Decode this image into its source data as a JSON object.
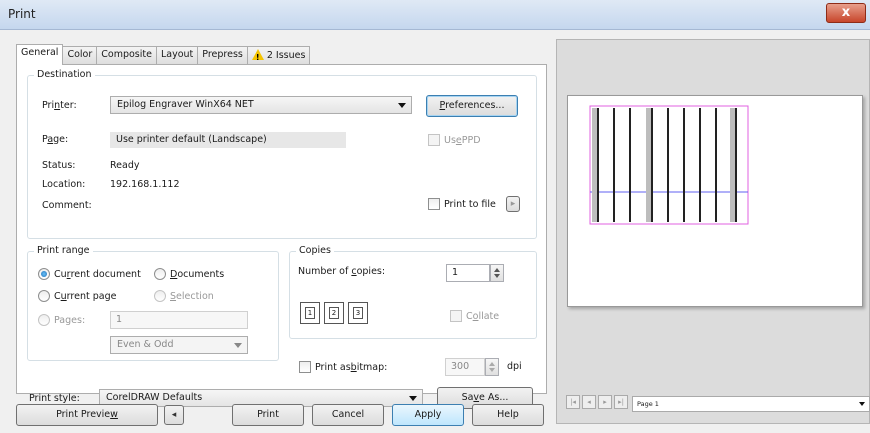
{
  "window": {
    "title": "Print",
    "close_glyph": "x"
  },
  "tabs": [
    {
      "label": "General"
    },
    {
      "label": "Color"
    },
    {
      "label": "Composite"
    },
    {
      "label": "Layout"
    },
    {
      "label": "Prepress"
    },
    {
      "label": "2 Issues",
      "icon": "warning-icon"
    }
  ],
  "destination": {
    "group_title": "Destination",
    "printer_label_pre": "Pri",
    "printer_label_u": "n",
    "printer_label_post": "ter:",
    "printer_value": "Epilog Engraver WinX64 NET",
    "preferences_pre": "",
    "preferences_u": "P",
    "preferences_post": "references...",
    "page_label_pre": "P",
    "page_label_u": "a",
    "page_label_post": "ge:",
    "page_value": "Use printer default (Landscape)",
    "use_ppd_pre": "Us",
    "use_ppd_u": "e",
    "use_ppd_post": " PPD",
    "status_label": "Status:",
    "status_value": "Ready",
    "location_label": "Location:",
    "location_value": "192.168.1.112",
    "comment_label": "Comment:",
    "print_to_file_label": "Print to file",
    "print_to_file_arrow": "▸"
  },
  "print_range": {
    "group_title": "Print range",
    "current_document_pre": "Cu",
    "current_document_u": "r",
    "current_document_post": "rent document",
    "documents_pre": "",
    "documents_u": "D",
    "documents_post": "ocuments",
    "current_page_pre": "C",
    "current_page_u": "u",
    "current_page_post": "rrent page",
    "selection_pre": "",
    "selection_u": "S",
    "selection_post": "election",
    "pages_label": "Pages:",
    "pages_value": "1",
    "odd_even_value": "Even & Odd",
    "selected": "current_document"
  },
  "copies": {
    "group_title": "Copies",
    "number_label_pre": "Number of ",
    "number_label_u": "c",
    "number_label_post": "opies:",
    "number_value": "1",
    "collate_label_pre": "C",
    "collate_label_u": "o",
    "collate_label_post": "llate",
    "collate_icon_labels": [
      "1",
      "2",
      "3"
    ]
  },
  "bitmap": {
    "label_pre": "Print as ",
    "label_u": "b",
    "label_post": "itmap:",
    "dpi_value": "300",
    "dpi_unit": "dpi"
  },
  "style": {
    "label": "Print style:",
    "value": "CorelDRAW Defaults",
    "save_as_pre": "Sa",
    "save_as_u": "v",
    "save_as_post": "e As..."
  },
  "buttons": {
    "print_preview_pre": "Print Previe",
    "print_preview_u": "w",
    "print_preview_post": "",
    "preview_toggle_glyph": "◂",
    "print": "Print",
    "cancel": "Cancel",
    "apply": "Apply",
    "help": "Help"
  },
  "preview": {
    "page_selector": "Page 1",
    "nav": [
      "|◂",
      "◂",
      "▸",
      "▸|"
    ]
  },
  "colors": {
    "selection_accent": "#1f6eb8",
    "preview_guides": "#e060e0",
    "preview_axis": "#6060f0"
  }
}
